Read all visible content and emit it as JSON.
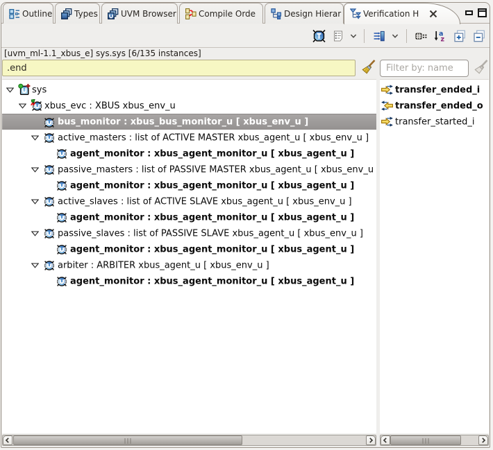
{
  "window": {
    "accent_color": "#3a6cb4",
    "background_color": "#efeeec",
    "selection_color": "#9b9896"
  },
  "tabs": [
    {
      "label": "Outline",
      "icon": "outline-icon",
      "active": false
    },
    {
      "label": "Types",
      "icon": "types-icon",
      "active": false
    },
    {
      "label": "UVM Browser",
      "icon": "uvm-browser-icon",
      "active": false
    },
    {
      "label": "Compile Orde",
      "icon": "compile-order-icon",
      "active": false
    },
    {
      "label": "Design Hierar",
      "icon": "design-hierarchy-icon",
      "active": false
    },
    {
      "label": "Verification H",
      "icon": "verification-hierarchy-icon",
      "active": true,
      "closable": true
    }
  ],
  "window_controls": {
    "minimize": "minimize",
    "maximize": "maximize"
  },
  "toolbar": {
    "buttons": [
      {
        "name": "filter-types",
        "icon": "type-filter-icon"
      },
      {
        "name": "view-menu",
        "icon": "view-menu-icon",
        "has_dropdown": true
      },
      {
        "name": "filter-settings",
        "icon": "filter-settings-icon",
        "has_dropdown": true
      },
      {
        "name": "show-ports",
        "icon": "ports-icon"
      },
      {
        "name": "sort-alphabetically",
        "icon": "sort-az-icon"
      },
      {
        "name": "expand-all",
        "icon": "expand-all-icon"
      },
      {
        "name": "collapse-all",
        "icon": "collapse-all-icon"
      }
    ]
  },
  "header": {
    "breadcrumb": "[uvm_ml-1.1_xbus_e] sys.sys [6/135 instances]"
  },
  "filter": {
    "path_value": ".end",
    "name_placeholder": "Filter by: name",
    "clear_path_button": "clear-path",
    "clear_name_button": "clear-name"
  },
  "tree": {
    "rows": [
      {
        "label": "sys",
        "level": 0,
        "expanded": true,
        "icon": "sys-unit-icon",
        "bold": false,
        "selected": false
      },
      {
        "label": "xbus_evc : XBUS xbus_env_u",
        "level": 1,
        "expanded": true,
        "icon": "env-unit-icon",
        "bold": false,
        "selected": false
      },
      {
        "label": "bus_monitor : xbus_bus_monitor_u [ xbus_env_u ]",
        "level": 2,
        "expanded": false,
        "icon": "unit-icon",
        "bold": true,
        "selected": true
      },
      {
        "label": "active_masters : list of ACTIVE MASTER xbus_agent_u [ xbus_env_u ]",
        "level": 2,
        "expanded": true,
        "icon": "unit-icon",
        "bold": false,
        "selected": false
      },
      {
        "label": "agent_monitor : xbus_agent_monitor_u [ xbus_agent_u ]",
        "level": 3,
        "expanded": false,
        "icon": "unit-icon",
        "bold": true,
        "selected": false
      },
      {
        "label": "passive_masters : list of PASSIVE MASTER xbus_agent_u [ xbus_env_u ]",
        "level": 2,
        "expanded": true,
        "icon": "unit-icon",
        "bold": false,
        "selected": false
      },
      {
        "label": "agent_monitor : xbus_agent_monitor_u [ xbus_agent_u ]",
        "level": 3,
        "expanded": false,
        "icon": "unit-icon",
        "bold": true,
        "selected": false
      },
      {
        "label": "active_slaves : list of ACTIVE SLAVE xbus_agent_u [ xbus_env_u ]",
        "level": 2,
        "expanded": true,
        "icon": "unit-icon",
        "bold": false,
        "selected": false
      },
      {
        "label": "agent_monitor : xbus_agent_monitor_u [ xbus_agent_u ]",
        "level": 3,
        "expanded": false,
        "icon": "unit-icon",
        "bold": true,
        "selected": false
      },
      {
        "label": "passive_slaves : list of PASSIVE SLAVE xbus_agent_u [ xbus_env_u ]",
        "level": 2,
        "expanded": true,
        "icon": "unit-icon",
        "bold": false,
        "selected": false
      },
      {
        "label": "agent_monitor : xbus_agent_monitor_u [ xbus_agent_u ]",
        "level": 3,
        "expanded": false,
        "icon": "unit-icon",
        "bold": true,
        "selected": false
      },
      {
        "label": "arbiter : ARBITER xbus_agent_u [ xbus_env_u ]",
        "level": 2,
        "expanded": true,
        "icon": "unit-icon",
        "bold": false,
        "selected": false
      },
      {
        "label": "agent_monitor : xbus_agent_monitor_u [ xbus_agent_u ]",
        "level": 3,
        "expanded": false,
        "icon": "unit-icon",
        "bold": true,
        "selected": false
      }
    ]
  },
  "ports": {
    "items": [
      {
        "label": "transfer_ended_i",
        "direction": "in",
        "bold": true
      },
      {
        "label": "transfer_ended_o",
        "direction": "out",
        "bold": true
      },
      {
        "label": "transfer_started_i",
        "direction": "in",
        "bold": false
      }
    ]
  }
}
